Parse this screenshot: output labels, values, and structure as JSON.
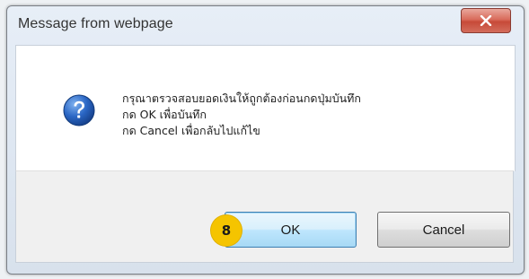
{
  "dialog": {
    "title": "Message from webpage",
    "close_icon": "close-icon",
    "message_icon": "question-icon",
    "message_lines": [
      "กรุณาตรวจสอบยอดเงินให้ถูกต้องก่อนกดปุ่มบันทึก",
      "กด OK เพื่อบันทึก",
      "กด Cancel เพื่อกลับไปแก้ไข"
    ],
    "ok_label": "OK",
    "cancel_label": "Cancel"
  },
  "step_marker": {
    "number": "8",
    "color": "#f5c400"
  },
  "colors": {
    "close_button": "#c74a38",
    "question_icon": "#1f5fb8"
  }
}
